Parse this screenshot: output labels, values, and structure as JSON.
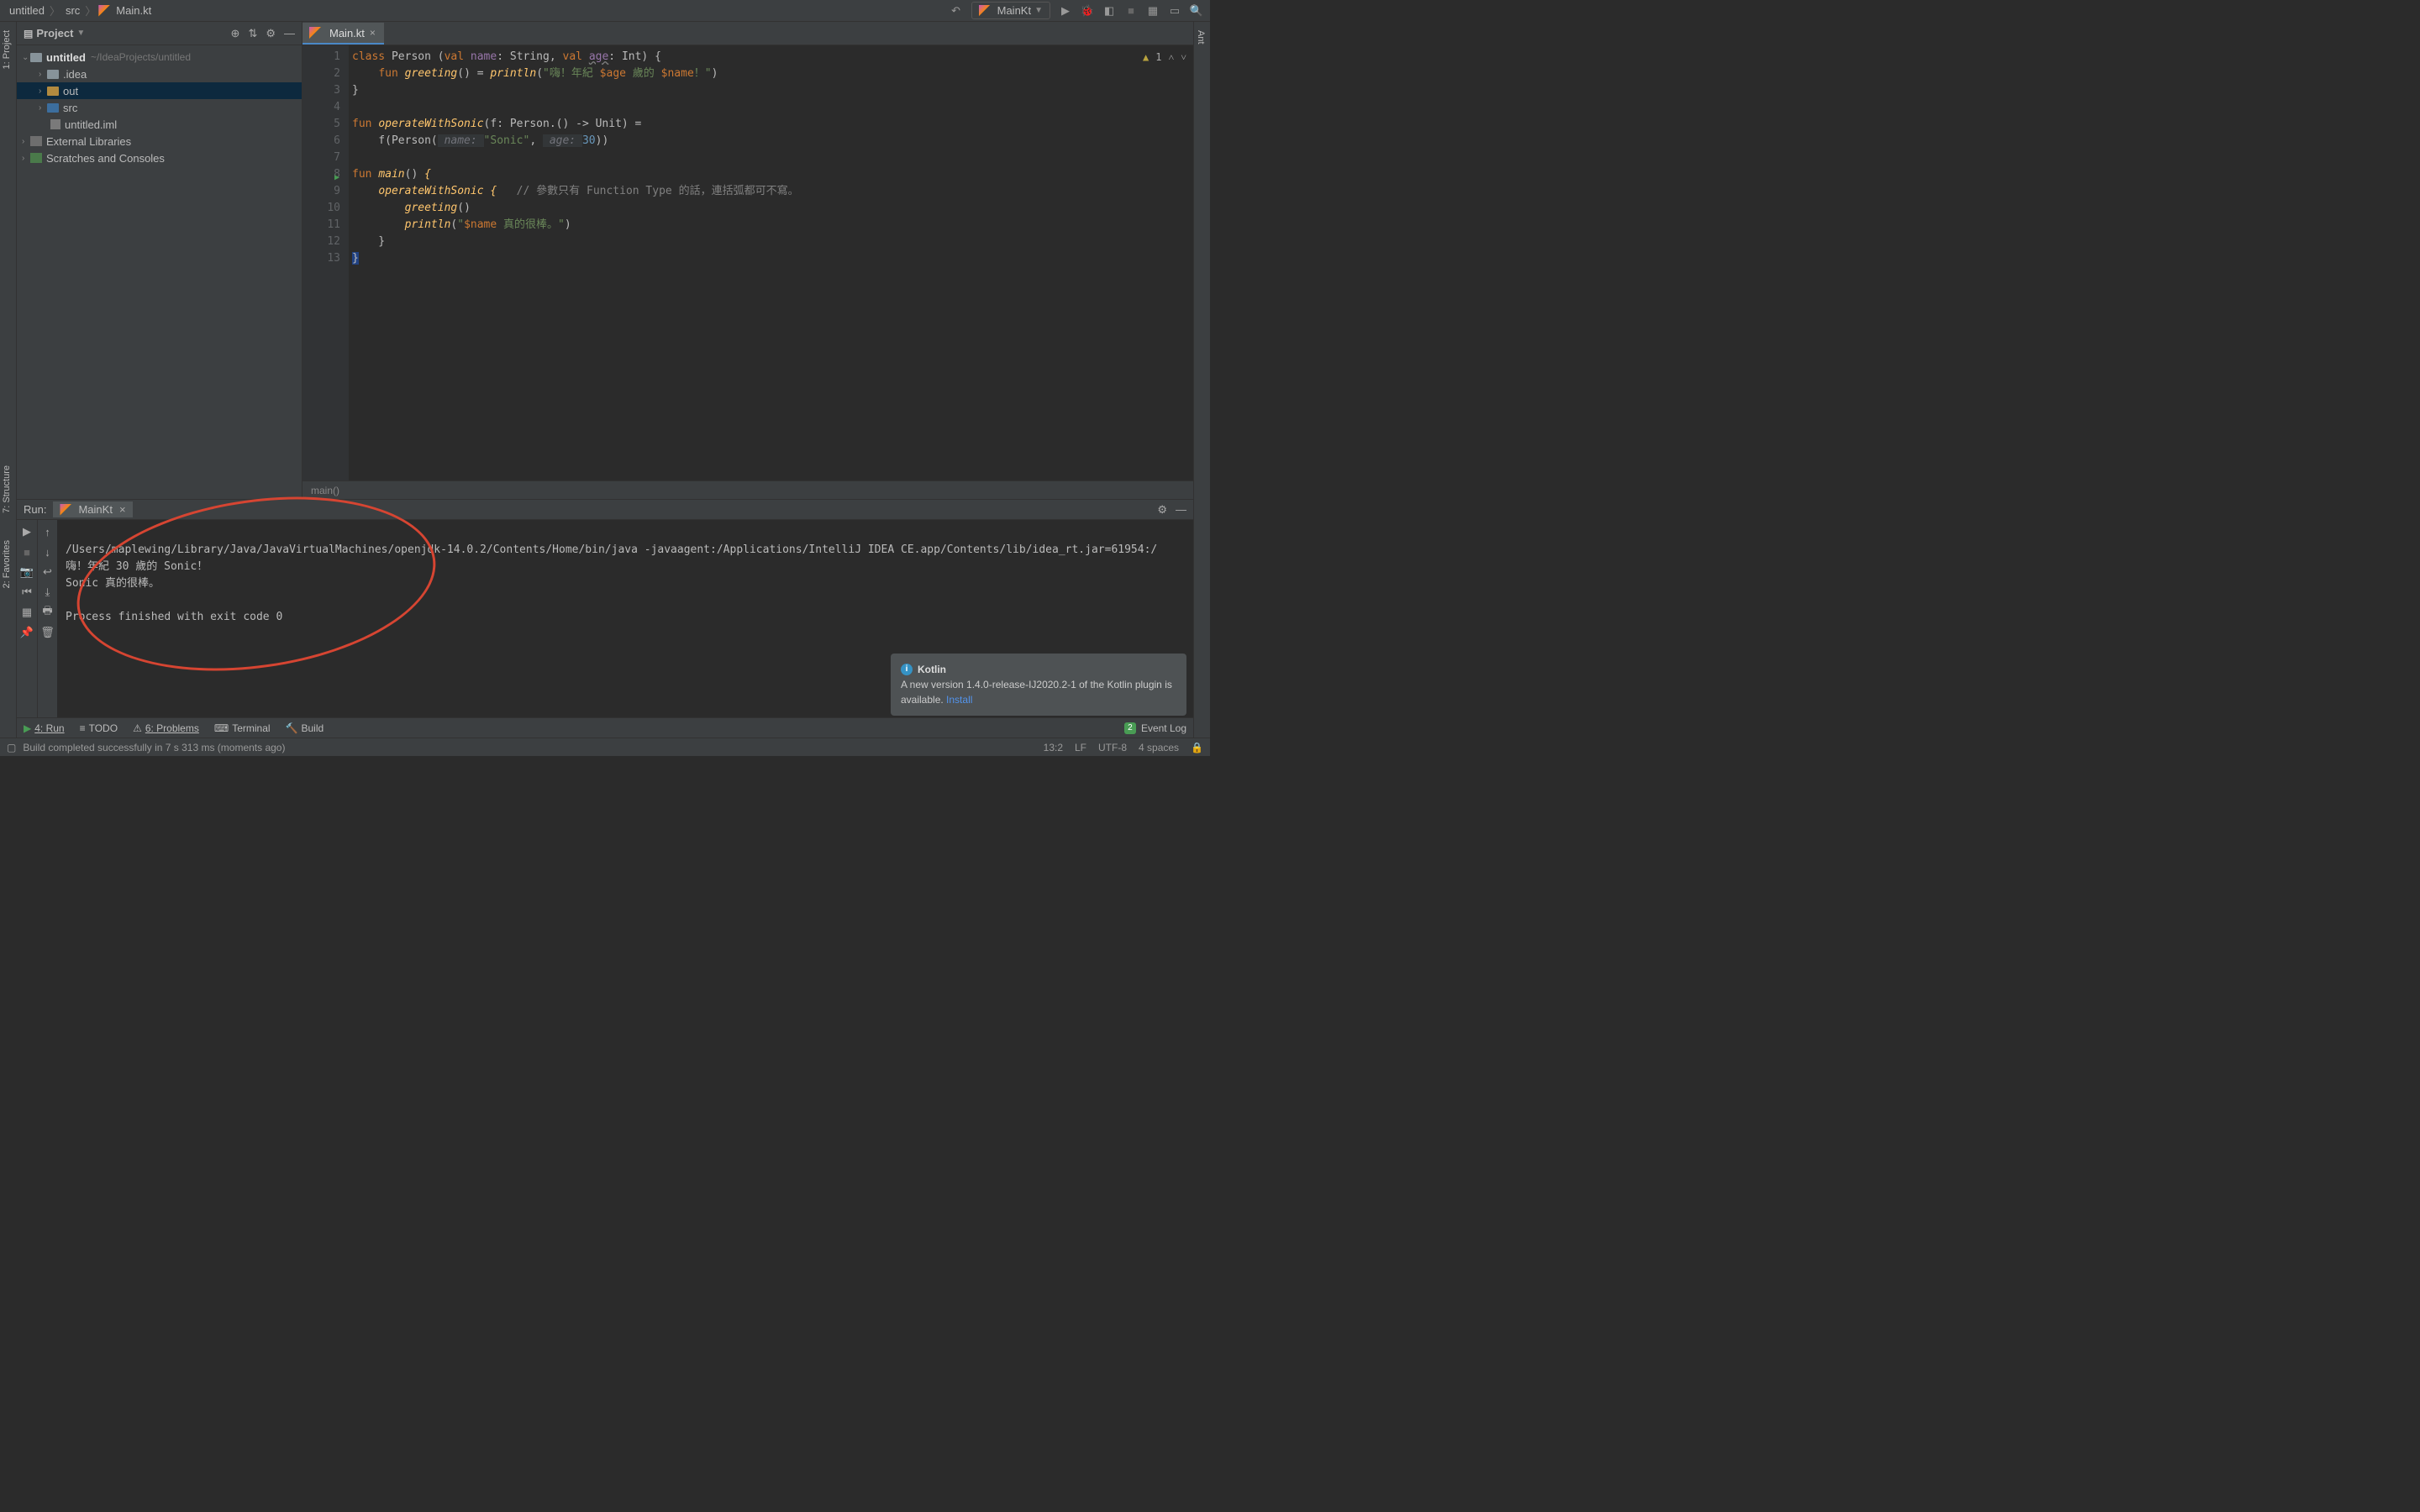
{
  "breadcrumb": {
    "project": "untitled",
    "folder": "src",
    "file": "Main.kt"
  },
  "runConfig": {
    "name": "MainKt"
  },
  "projectPanel": {
    "title": "Project",
    "tree": {
      "root": {
        "name": "untitled",
        "path": "~/IdeaProjects/untitled"
      },
      "items": [
        {
          "name": ".idea",
          "kind": "folder"
        },
        {
          "name": "out",
          "kind": "folder-gold",
          "selected": true
        },
        {
          "name": "src",
          "kind": "folder"
        },
        {
          "name": "untitled.iml",
          "kind": "file"
        }
      ],
      "libs": "External Libraries",
      "scratches": "Scratches and Consoles"
    }
  },
  "editor": {
    "tab": "Main.kt",
    "lines": [
      1,
      2,
      3,
      4,
      5,
      6,
      7,
      8,
      9,
      10,
      11,
      12,
      13
    ],
    "inspection": {
      "count": "1"
    },
    "breadcrumb": "main()",
    "code": {
      "l1": {
        "a": "class ",
        "b": "Person ",
        "c": "(",
        "d": "val ",
        "e": "name",
        "f": ": String, ",
        "g": "val ",
        "h": "age",
        "i": ": Int) {"
      },
      "l2": {
        "a": "    ",
        "b": "fun ",
        "c": "greeting",
        "d": "() = ",
        "e": "println",
        "f": "(",
        "g": "\"嗨！年紀 ",
        "h": "$age",
        "i": " 歲的 ",
        "j": "$name",
        "k": "！\"",
        "l": ")"
      },
      "l3": "}",
      "l5": {
        "a": "fun ",
        "b": "operateWithSonic",
        "c": "(f: Person.() -> Unit) ="
      },
      "l6": {
        "a": "    f(Person(",
        "b": " name: ",
        "c": "\"Sonic\"",
        "d": ", ",
        "e": " age: ",
        "f": "30",
        "g": "))"
      },
      "l8": {
        "a": "fun ",
        "b": "main",
        "c": "() ",
        "d": "{"
      },
      "l9": {
        "a": "    ",
        "b": "operateWithSonic ",
        "c": "{",
        "d": "   // 參數只有 Function Type 的話，連括弧都可不寫。"
      },
      "l10": {
        "a": "        ",
        "b": "greeting",
        "c": "()"
      },
      "l11": {
        "a": "        ",
        "b": "println",
        "c": "(",
        "d": "\"",
        "e": "$name",
        "f": " 真的很棒。\"",
        "g": ")"
      },
      "l12": "    }",
      "l13": "}"
    }
  },
  "run": {
    "title": "Run:",
    "tab": "MainKt",
    "out1": "/Users/maplewing/Library/Java/JavaVirtualMachines/openjdk-14.0.2/Contents/Home/bin/java -javaagent:/Applications/IntelliJ IDEA CE.app/Contents/lib/idea_rt.jar=61954:/",
    "out2": "嗨！年紀 30 歲的 Sonic！",
    "out3": "Sonic 真的很棒。",
    "out4": "",
    "out5": "Process finished with exit code 0"
  },
  "balloon": {
    "title": "Kotlin",
    "body": "A new version 1.4.0-release-IJ2020.2-1 of the Kotlin plugin is available. ",
    "link": "Install"
  },
  "bottomTools": {
    "run": "4: Run",
    "todo": "TODO",
    "problems": "6: Problems",
    "terminal": "Terminal",
    "build": "Build",
    "eventLog": "Event Log",
    "badge": "2"
  },
  "statusbar": {
    "msg": "Build completed successfully in 7 s 313 ms (moments ago)",
    "pos": "13:2",
    "sep": "LF",
    "enc": "UTF-8",
    "indent": "4 spaces"
  },
  "rails": {
    "project": "1: Project",
    "structure": "7: Structure",
    "favorites": "2: Favorites",
    "ant": "Ant"
  }
}
